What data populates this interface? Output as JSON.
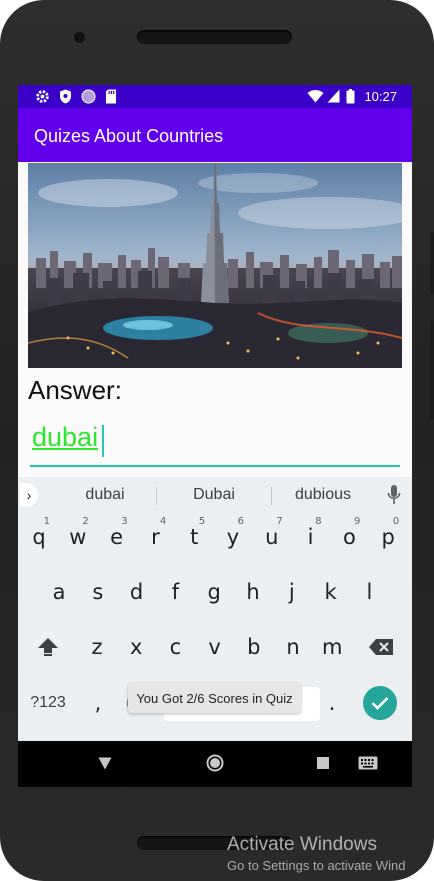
{
  "status_bar": {
    "time": "10:27",
    "left_icons": [
      "settings-icon",
      "shield-icon",
      "circle-icon",
      "sd-card-icon"
    ],
    "right_icons": [
      "wifi-icon",
      "signal-icon",
      "battery-icon"
    ]
  },
  "app_bar": {
    "title": "Quizes About Countries"
  },
  "quiz": {
    "image": "dubai-skyline-photo",
    "answer_label": "Answer:",
    "answer_value": "dubai"
  },
  "keyboard": {
    "suggestions": [
      "dubai",
      "Dubai",
      "dubious"
    ],
    "row1": [
      {
        "k": "q",
        "h": "1"
      },
      {
        "k": "w",
        "h": "2"
      },
      {
        "k": "e",
        "h": "3"
      },
      {
        "k": "r",
        "h": "4"
      },
      {
        "k": "t",
        "h": "5"
      },
      {
        "k": "y",
        "h": "6"
      },
      {
        "k": "u",
        "h": "7"
      },
      {
        "k": "i",
        "h": "8"
      },
      {
        "k": "o",
        "h": "9"
      },
      {
        "k": "p",
        "h": "0"
      }
    ],
    "row2": [
      "a",
      "s",
      "d",
      "f",
      "g",
      "h",
      "j",
      "k",
      "l"
    ],
    "row3": [
      "z",
      "x",
      "c",
      "v",
      "b",
      "n",
      "m"
    ],
    "symbols_label": "?123",
    "comma": ",",
    "period": "."
  },
  "toast": {
    "message": "You Got 2/6 Scores in Quiz"
  },
  "colors": {
    "status_bar": "#3a00c8",
    "app_bar": "#6200ee",
    "accent": "#26c6b9",
    "answer_text": "#2ee82e",
    "enter_key": "#26a69a"
  },
  "watermark": {
    "title": "Activate Windows",
    "subtitle": "Go to Settings to activate Wind"
  }
}
